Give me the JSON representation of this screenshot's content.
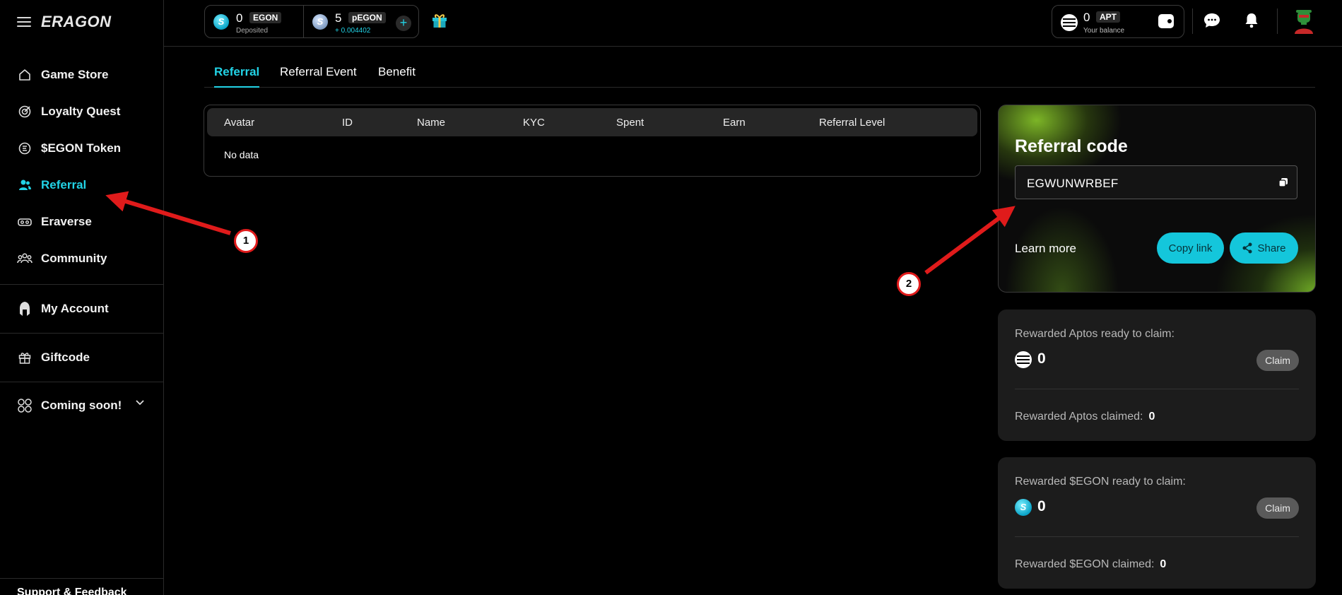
{
  "app": {
    "logo": "ERAGON"
  },
  "sidebar": {
    "items": [
      {
        "label": "Game Store",
        "icon": "home-icon"
      },
      {
        "label": "Loyalty Quest",
        "icon": "target-icon"
      },
      {
        "label": "$EGON Token",
        "icon": "token-icon"
      },
      {
        "label": "Referral",
        "icon": "users-icon",
        "active": true
      },
      {
        "label": "Eraverse",
        "icon": "vr-headset-icon"
      },
      {
        "label": "Community",
        "icon": "community-icon"
      }
    ],
    "account": {
      "label": "My Account",
      "icon": "spartan-helmet-icon"
    },
    "giftcode": {
      "label": "Giftcode",
      "icon": "gift-icon"
    },
    "coming": {
      "label": "Coming soon!",
      "icon": "grid-icon"
    },
    "support": {
      "label": "Support & Feedback"
    }
  },
  "topbar": {
    "egon": {
      "value": "0",
      "tag": "EGON",
      "sub": "Deposited"
    },
    "pegon": {
      "value": "5",
      "tag": "pEGON",
      "sub": "+ 0.004402"
    },
    "balance": {
      "value": "0",
      "tag": "APT",
      "sub": "Your balance"
    }
  },
  "tabs": [
    {
      "label": "Referral",
      "active": true
    },
    {
      "label": "Referral Event"
    },
    {
      "label": "Benefit"
    }
  ],
  "table": {
    "columns": [
      "Avatar",
      "ID",
      "Name",
      "KYC",
      "Spent",
      "Earn",
      "Referral Level"
    ],
    "empty": "No data"
  },
  "referral": {
    "title": "Referral code",
    "code": "EGWUNWRBEF",
    "learn_more": "Learn more",
    "copy_link": "Copy link",
    "share": "Share"
  },
  "rewards": {
    "aptos": {
      "ready_label": "Rewarded Aptos ready to claim:",
      "ready_value": "0",
      "claim": "Claim",
      "claimed_label": "Rewarded Aptos claimed:",
      "claimed_value": "0"
    },
    "egon": {
      "ready_label": "Rewarded $EGON ready to claim:",
      "ready_value": "0",
      "claim": "Claim",
      "claimed_label": "Rewarded $EGON claimed:",
      "claimed_value": "0"
    }
  },
  "annotations": {
    "marker1": "1",
    "marker2": "2"
  },
  "colors": {
    "accent": "#22d3e6",
    "arrow": "#e01b1b"
  }
}
